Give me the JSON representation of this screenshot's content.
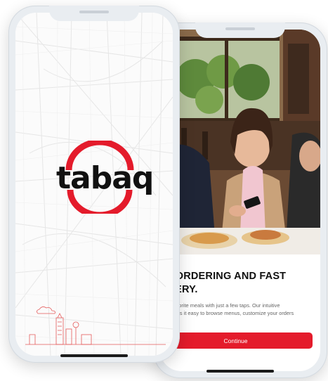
{
  "splash": {
    "logo_text": "tabaq"
  },
  "onboarding": {
    "headline_line1": "SY ORDERING AND FAST",
    "headline_line2": "LIVERY.",
    "body_line1": "your favorite meals with just a few taps. Our intuitive",
    "body_line2": "ce makes it easy to browse menus, customize your orders",
    "continue_label": "Continue"
  },
  "colors": {
    "brand_red": "#e41b2b",
    "frame": "#e9edf1"
  }
}
